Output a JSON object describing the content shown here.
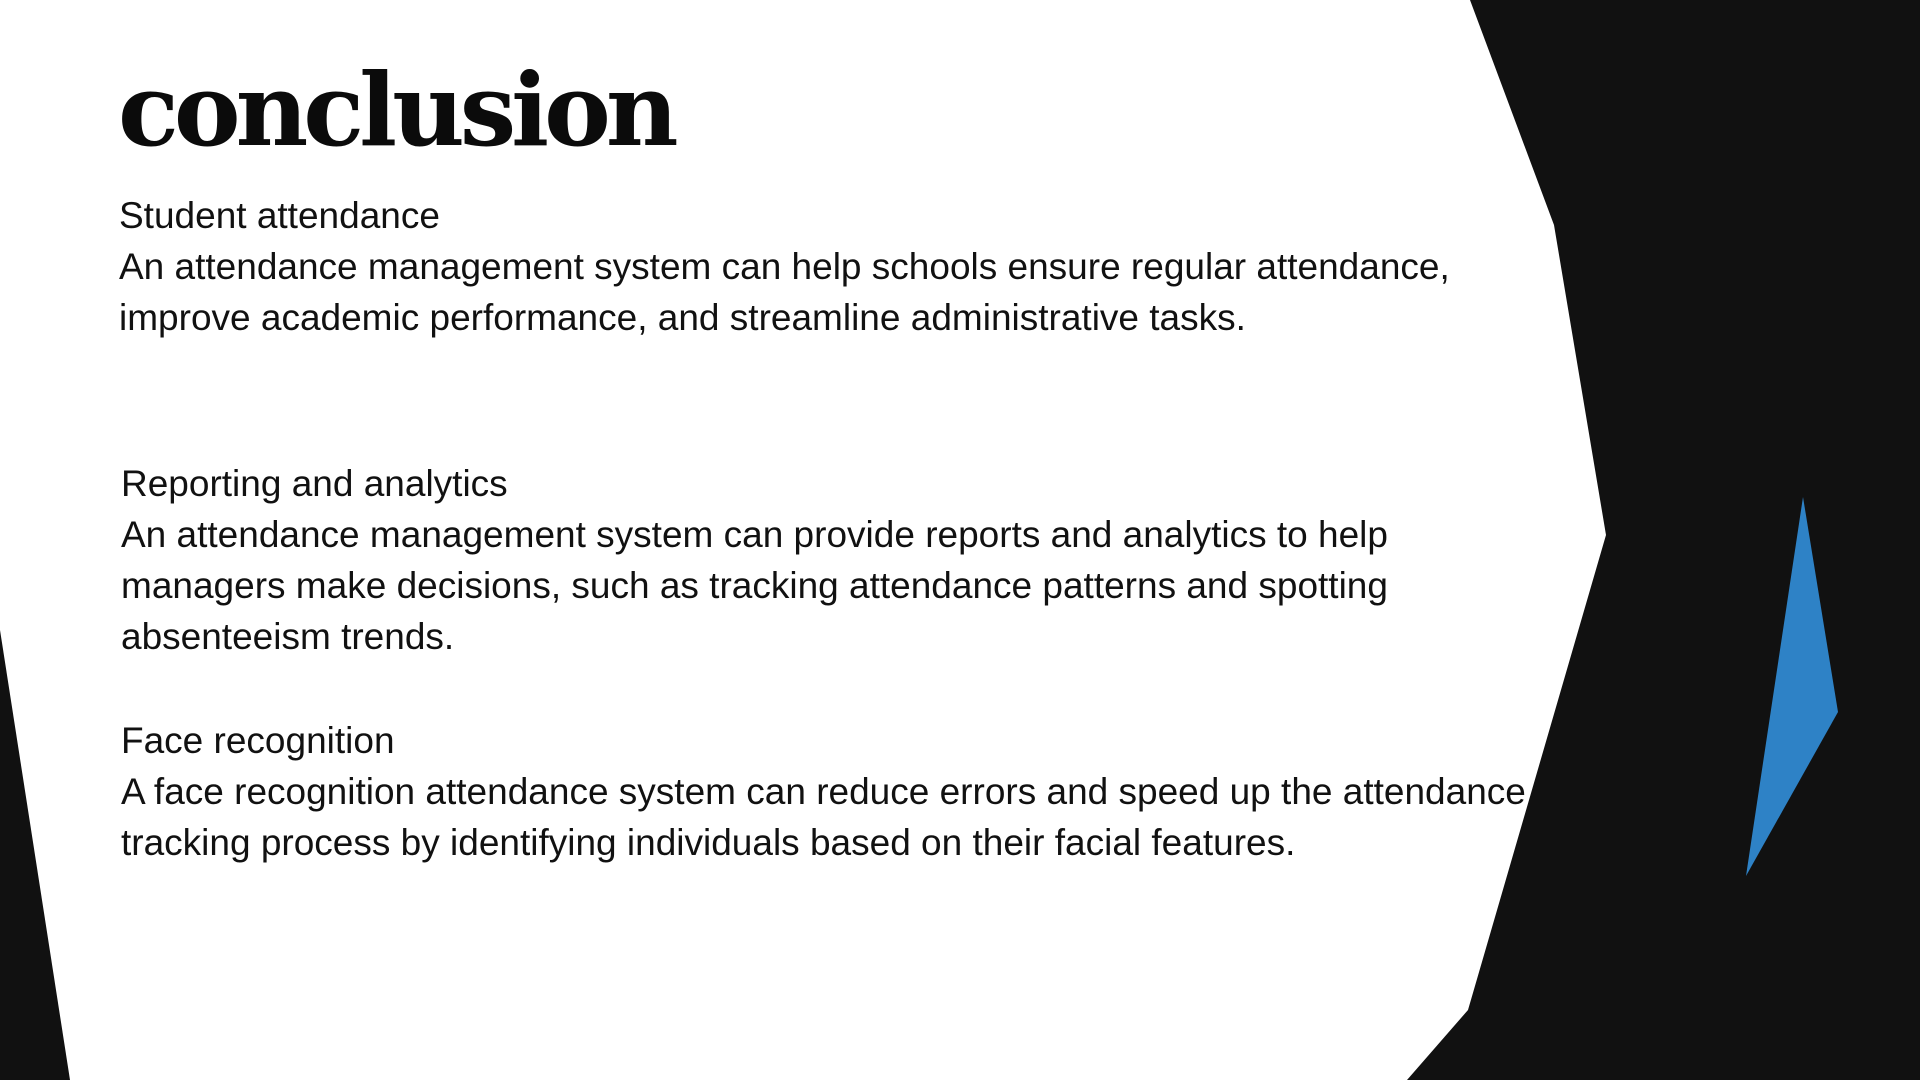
{
  "slide": {
    "title": "conclusion",
    "sections": [
      {
        "heading": "Student attendance",
        "body": "An attendance management system can help schools ensure regular attendance, improve academic performance, and streamline administrative tasks."
      },
      {
        "heading": "Reporting and analytics",
        "body": "An attendance management system can provide reports and analytics to help managers make decisions, such as tracking attendance patterns and spotting absenteeism trends."
      },
      {
        "heading": "Face recognition",
        "body": "A face recognition attendance system can reduce errors and speed up the attendance tracking process by identifying individuals based on their facial features."
      }
    ]
  },
  "colors": {
    "background": "#ffffff",
    "dark_shape": "#111111",
    "accent_blue": "#2e82c6",
    "text": "#111111"
  }
}
